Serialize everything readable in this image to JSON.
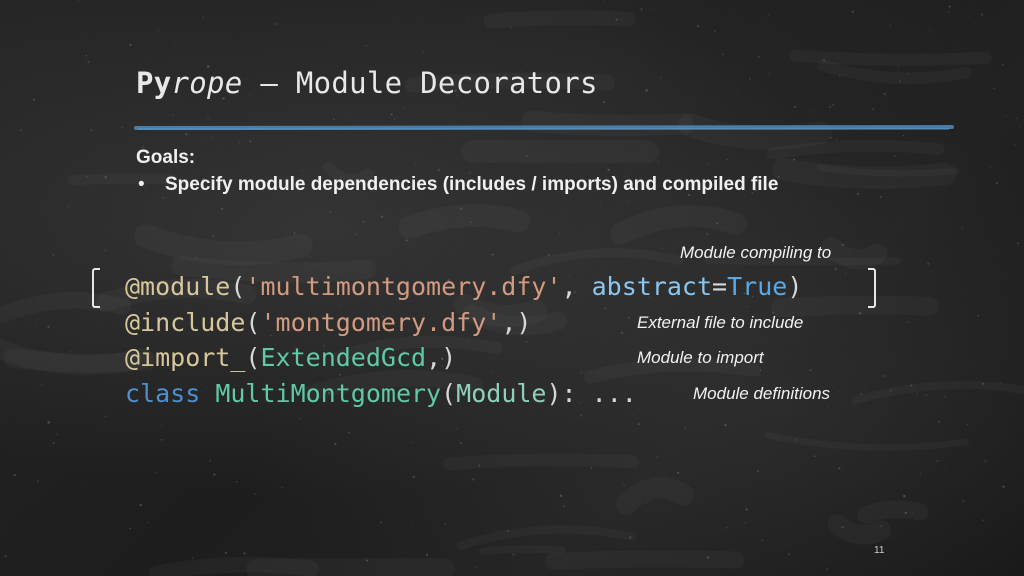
{
  "slide": {
    "title": {
      "bold_part": "Py",
      "italic_part": "rope",
      "rest": " – Module Decorators"
    },
    "goals_label": "Goals:",
    "bullet_char": "•",
    "goal_item": "Specify module dependencies (includes / imports) and compiled file",
    "code": {
      "line1": {
        "decorator": "@module",
        "open": "(",
        "string": "'multimontgomery.dfy'",
        "comma": ", ",
        "kwarg": "abstract",
        "eq": "=",
        "value": "True",
        "close": ")"
      },
      "line2": {
        "decorator": "@include",
        "open": "(",
        "string": "'montgomery.dfy'",
        "comma": ",",
        "close": ")"
      },
      "line3": {
        "decorator": "@import_",
        "open": "(",
        "ident": "ExtendedGcd",
        "comma": ",",
        "close": ")"
      },
      "line4": {
        "keyword": "class",
        "space": " ",
        "name": "MultiMontgomery",
        "open": "(",
        "base": "Module",
        "close": "):",
        "ellipsis": " ..."
      }
    },
    "annotations": {
      "compile": "Module compiling to",
      "include": "External file to include",
      "import": "Module to import",
      "definitions": "Module definitions"
    },
    "page_number": "11",
    "colors": {
      "background": "#1c1c1c",
      "rule": "#4a86b8",
      "decorator": "#d6c79c",
      "string": "#d29a80",
      "keyword": "#4f8fd0",
      "class_name": "#5fc9a8"
    }
  }
}
